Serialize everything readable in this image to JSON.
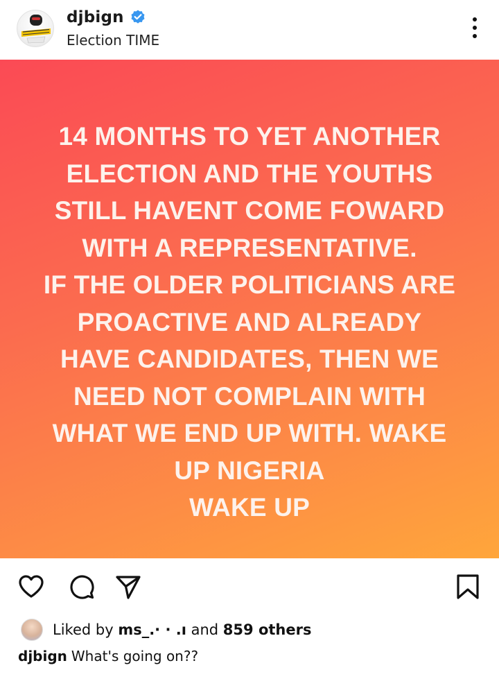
{
  "header": {
    "username": "djbign",
    "subtitle": "Election TIME",
    "verified_icon": "verified-badge-icon",
    "more_icon": "more-vertical-icon",
    "verified_color": "#3897f0"
  },
  "post": {
    "lines": [
      "14 MONTHS TO YET ANOTHER",
      "ELECTION AND THE YOUTHS",
      "STILL HAVENT COME FOWARD",
      "WITH A REPRESENTATIVE.",
      "IF THE OLDER POLITICIANS ARE",
      "PROACTIVE AND ALREADY",
      "HAVE CANDIDATES, THEN WE",
      "NEED NOT COMPLAIN WITH",
      "WHAT WE END UP WITH. WAKE",
      "UP NIGERIA",
      "WAKE UP"
    ],
    "gradient_start": "#fb4a55",
    "gradient_end": "#ffa63b",
    "text_color": "#fdf2ec"
  },
  "actions": {
    "like_icon": "heart-icon",
    "comment_icon": "comment-icon",
    "share_icon": "share-icon",
    "save_icon": "bookmark-icon"
  },
  "likes": {
    "prefix": "Liked by ",
    "user": "ms_.·  ·  .ı",
    "middle": " and ",
    "others": "859 others"
  },
  "caption": {
    "user": "djbign",
    "text": "What's going on??"
  }
}
